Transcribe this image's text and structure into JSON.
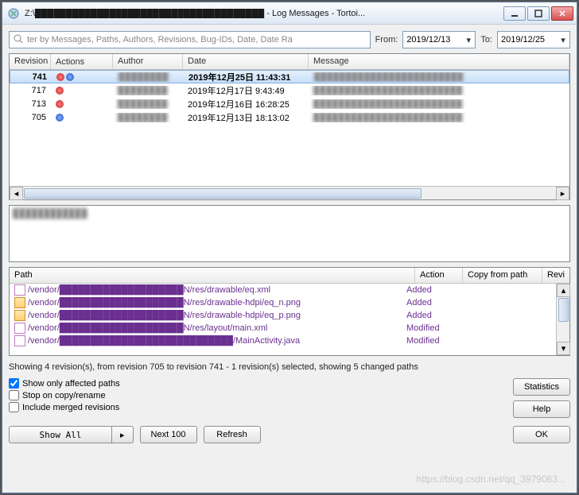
{
  "window": {
    "title": "Z:\\█████████████████████████████████████ - Log Messages - Tortoi..."
  },
  "filter": {
    "placeholder": "ter by Messages, Paths, Authors, Revisions, Bug-IDs, Date, Date Ra",
    "from_label": "From:",
    "from_date": "2019/12/13",
    "to_label": "To:",
    "to_date": "2019/12/25"
  },
  "revHeaders": {
    "rev": "Revision",
    "act": "Actions",
    "auth": "Author",
    "date": "Date",
    "msg": "Message"
  },
  "revisions": [
    {
      "rev": "741",
      "date": "2019年12月25日 11:43:31",
      "selected": true,
      "actR": true,
      "actB": true
    },
    {
      "rev": "717",
      "date": "2019年12月17日 9:43:49",
      "selected": false,
      "actR": true,
      "actB": false
    },
    {
      "rev": "713",
      "date": "2019年12月16日 16:28:25",
      "selected": false,
      "actR": true,
      "actB": false
    },
    {
      "rev": "705",
      "date": "2019年12月13日 18:13:02",
      "selected": false,
      "actR": false,
      "actB": true
    }
  ],
  "pathHeaders": {
    "path": "Path",
    "action": "Action",
    "copy": "Copy from path",
    "rev": "Revi"
  },
  "paths": [
    {
      "icon": "file",
      "path": "/vendor/████████████████████N/res/drawable/eq.xml",
      "action": "Added"
    },
    {
      "icon": "img",
      "path": "/vendor/████████████████████N/res/drawable-hdpi/eq_n.png",
      "action": "Added"
    },
    {
      "icon": "img",
      "path": "/vendor/████████████████████N/res/drawable-hdpi/eq_p.png",
      "action": "Added"
    },
    {
      "icon": "file",
      "path": "/vendor/████████████████████N/res/layout/main.xml",
      "action": "Modified"
    },
    {
      "icon": "file",
      "path": "/vendor/████████████████████████████/MainActivity.java",
      "action": "Modified"
    }
  ],
  "status": "Showing 4 revision(s), from revision 705 to revision 741 - 1 revision(s) selected, showing 5 changed paths",
  "checks": {
    "affected": "Show only affected paths",
    "stop": "Stop on copy/rename",
    "merged": "Include merged revisions"
  },
  "buttons": {
    "statistics": "Statistics",
    "help": "Help",
    "showall": "Show All",
    "next": "Next 100",
    "refresh": "Refresh",
    "ok": "OK"
  },
  "watermark": "https://blog.csdn.net/qq_3979063..."
}
